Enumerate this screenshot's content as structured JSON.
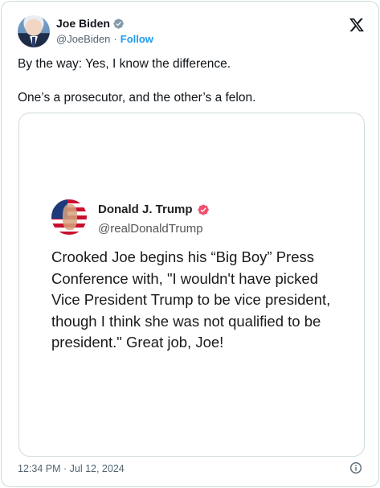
{
  "post": {
    "author": {
      "name": "Joe Biden",
      "handle": "@JoeBiden",
      "follow_label": "Follow"
    },
    "separator": "·",
    "text_lines": [
      "By the way: Yes, I know the difference.",
      "One’s a prosecutor, and the other’s a felon."
    ],
    "timestamp": "12:34 PM · Jul 12, 2024",
    "icons": {
      "verified": "verified-badge-gray",
      "brand": "x-logo",
      "info": "info-icon"
    }
  },
  "quoted": {
    "author": {
      "name": "Donald J. Trump",
      "handle": "@realDonaldTrump"
    },
    "text": "Crooked Joe begins his “Big Boy” Press Conference with, \"I wouldn't have picked Vice President Trump to be vice president, though I think she was not qualified to be president.\" Great job, Joe!",
    "badge_color": "#f0506e"
  },
  "colors": {
    "link": "#1d9bf0",
    "muted": "#536471",
    "border": "#cfd9de"
  }
}
